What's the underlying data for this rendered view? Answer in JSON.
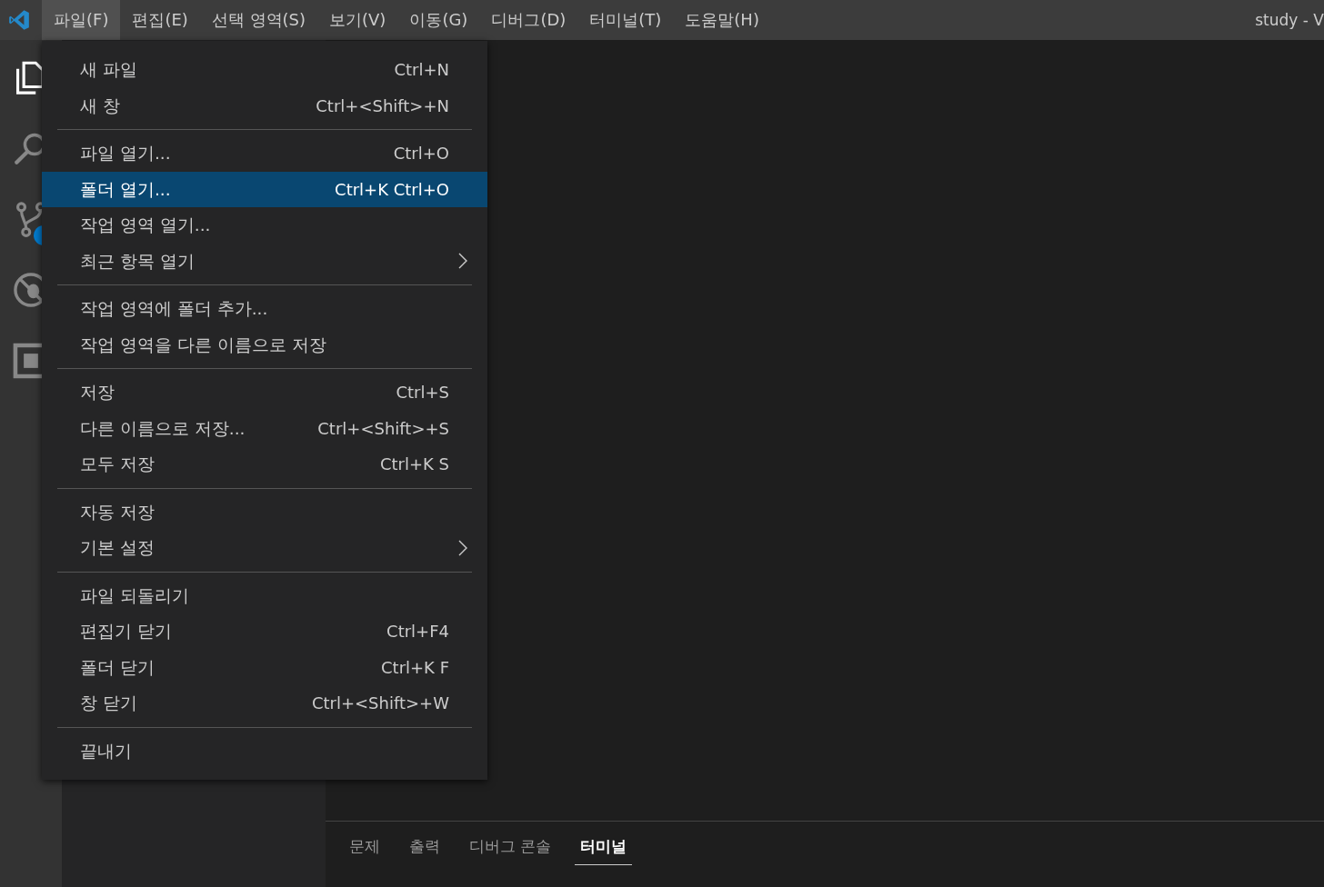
{
  "menubar": [
    {
      "label": "파일(F)",
      "selected": true
    },
    {
      "label": "편집(E)",
      "selected": false
    },
    {
      "label": "선택 영역(S)",
      "selected": false
    },
    {
      "label": "보기(V)",
      "selected": false
    },
    {
      "label": "이동(G)",
      "selected": false
    },
    {
      "label": "디버그(D)",
      "selected": false
    },
    {
      "label": "터미널(T)",
      "selected": false
    },
    {
      "label": "도움말(H)",
      "selected": false
    }
  ],
  "window_title": "study - V",
  "file_menu": {
    "groups": [
      [
        {
          "kind": "item",
          "label": "새 파일",
          "shortcut": "Ctrl+N",
          "selected": false
        },
        {
          "kind": "item",
          "label": "새 창",
          "shortcut": "Ctrl+<Shift>+N",
          "selected": false
        }
      ],
      [
        {
          "kind": "item",
          "label": "파일 열기...",
          "shortcut": "Ctrl+O",
          "selected": false
        },
        {
          "kind": "item",
          "label": "폴더 열기...",
          "shortcut": "Ctrl+K Ctrl+O",
          "selected": true
        },
        {
          "kind": "item",
          "label": "작업 영역 열기...",
          "selected": false
        },
        {
          "kind": "submenu",
          "label": "최근 항목 열기",
          "selected": false
        }
      ],
      [
        {
          "kind": "item",
          "label": "작업 영역에 폴더 추가...",
          "selected": false
        },
        {
          "kind": "item",
          "label": "작업 영역을 다른 이름으로 저장",
          "selected": false
        }
      ],
      [
        {
          "kind": "item",
          "label": "저장",
          "shortcut": "Ctrl+S",
          "selected": false
        },
        {
          "kind": "item",
          "label": "다른 이름으로 저장...",
          "shortcut": "Ctrl+<Shift>+S",
          "selected": false
        },
        {
          "kind": "item",
          "label": "모두 저장",
          "shortcut": "Ctrl+K S",
          "selected": false
        }
      ],
      [
        {
          "kind": "item",
          "label": "자동 저장",
          "selected": false
        },
        {
          "kind": "submenu",
          "label": "기본 설정",
          "selected": false
        }
      ],
      [
        {
          "kind": "item",
          "label": "파일 되돌리기",
          "selected": false
        },
        {
          "kind": "item",
          "label": "편집기 닫기",
          "shortcut": "Ctrl+F4",
          "selected": false
        },
        {
          "kind": "item",
          "label": "폴더 닫기",
          "shortcut": "Ctrl+K F",
          "selected": false
        },
        {
          "kind": "item",
          "label": "창 닫기",
          "shortcut": "Ctrl+<Shift>+W",
          "selected": false
        }
      ],
      [
        {
          "kind": "item",
          "label": "끝내기",
          "selected": false
        }
      ]
    ]
  },
  "panel": {
    "tabs": [
      {
        "label": "문제",
        "selected": false
      },
      {
        "label": "출력",
        "selected": false
      },
      {
        "label": "디버그 콘솔",
        "selected": false
      },
      {
        "label": "터미널",
        "selected": true
      }
    ]
  }
}
